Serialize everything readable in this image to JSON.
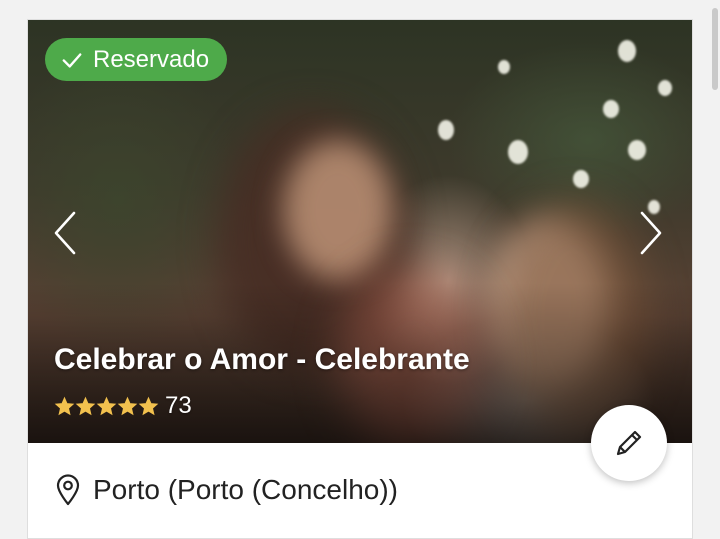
{
  "status_badge": {
    "label": "Reservado",
    "color": "#4eaa4a",
    "icon": "check-icon"
  },
  "vendor": {
    "name": "Celebrar o Amor - Celebrante",
    "rating": {
      "stars": 5,
      "max_stars": 5,
      "review_count": "73"
    },
    "location": "Porto (Porto (Concelho))"
  },
  "carousel": {
    "prev_icon": "chevron-left-icon",
    "next_icon": "chevron-right-icon"
  },
  "actions": {
    "edit_icon": "pencil-icon"
  },
  "colors": {
    "star": "#f2c14e",
    "text_dark": "#222222"
  }
}
